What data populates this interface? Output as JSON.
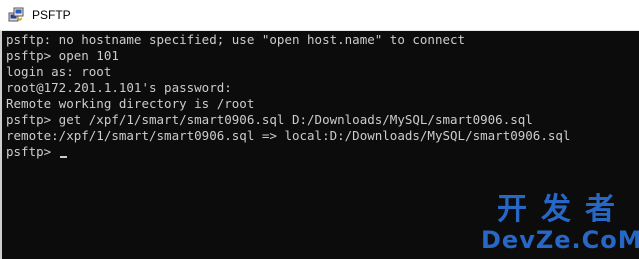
{
  "window": {
    "title": "PSFTP",
    "icon": "psftp-app-icon"
  },
  "console": {
    "lines": [
      "psftp: no hostname specified; use \"open host.name\" to connect",
      "psftp> open 101",
      "login as: root",
      "root@172.201.1.101's password:",
      "Remote working directory is /root",
      "psftp> get /xpf/1/smart/smart0906.sql D:/Downloads/MySQL/smart0906.sql",
      "remote:/xpf/1/smart/smart0906.sql => local:D:/Downloads/MySQL/smart0906.sql",
      "psftp> "
    ]
  },
  "watermark": {
    "top": "开发者",
    "bottom": "DevZe.CoM"
  }
}
